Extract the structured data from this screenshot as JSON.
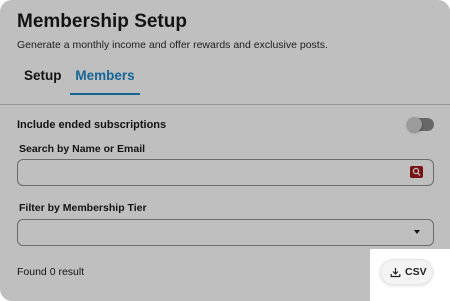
{
  "header": {
    "title": "Membership Setup",
    "subtitle": "Generate a monthly income and offer rewards and exclusive posts."
  },
  "tabs": [
    {
      "label": "Setup",
      "active": false
    },
    {
      "label": "Members",
      "active": true
    }
  ],
  "filters": {
    "include_ended_label": "Include ended subscriptions",
    "include_ended_on": false,
    "search_label": "Search by Name or Email",
    "search_value": "",
    "search_placeholder": "",
    "tier_label": "Filter by Membership Tier",
    "tier_selected": ""
  },
  "results": {
    "count_text": "Found 0 result"
  },
  "actions": {
    "csv_label": "CSV"
  },
  "colors": {
    "accent": "#1e88c7",
    "search_icon_bg": "#a01818",
    "overlay": "rgba(0,0,0,0.25)"
  },
  "icons": {
    "search": "search-icon",
    "dropdown": "chevron-down-icon",
    "download": "download-icon"
  }
}
